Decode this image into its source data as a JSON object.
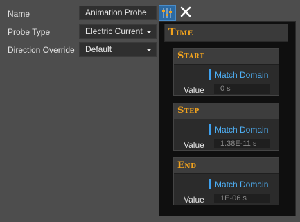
{
  "properties": {
    "name": {
      "label": "Name",
      "value": "Animation Probe"
    },
    "probe_type": {
      "label": "Probe Type",
      "value": "Electric Current"
    },
    "direction_override": {
      "label": "Direction Override",
      "value": "Default"
    }
  },
  "toolbar": {
    "options_icon": "sliders-icon",
    "close_icon": "close-icon"
  },
  "time_panel": {
    "title": "Time",
    "sections": [
      {
        "title": "Start",
        "match_label": "Match Domain",
        "value_label": "Value",
        "value": "0 s"
      },
      {
        "title": "Step",
        "match_label": "Match Domain",
        "value_label": "Value",
        "value": "1.38E-11 s"
      },
      {
        "title": "End",
        "match_label": "Match Domain",
        "value_label": "Value",
        "value": "1E-06 s"
      }
    ]
  },
  "colors": {
    "accent_orange": "#f0a21e",
    "accent_blue": "#3da0ee",
    "background": "#4d4d4d"
  }
}
